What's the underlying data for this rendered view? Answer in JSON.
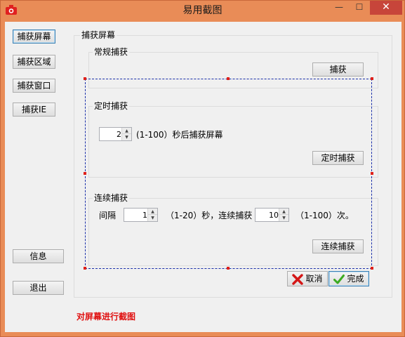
{
  "window": {
    "title": "易用截图"
  },
  "sidebar": {
    "capture_screen": "捕获屏幕",
    "capture_region": "捕获区域",
    "capture_window": "捕获窗口",
    "capture_ie": "捕获IE",
    "info": "信息",
    "exit": "退出"
  },
  "panel": {
    "title": "捕获屏幕",
    "normal": {
      "title": "常规捕获",
      "button": "捕获"
    },
    "timed": {
      "title": "定时捕获",
      "delay_value": "2",
      "range_text": "(1-100）秒后捕获屏幕",
      "button": "定时捕获"
    },
    "continuous": {
      "title": "连续捕获",
      "interval_label": "间隔",
      "interval_value": "1",
      "interval_range": "（1-20）秒，连续捕获",
      "count_value": "10",
      "count_range": "（1-100）次。",
      "button": "连续捕获"
    }
  },
  "actions": {
    "cancel": "取消",
    "done": "完成"
  },
  "status": "对屏幕进行截图",
  "colors": {
    "titlebar": "#e98c57",
    "close": "#c7453a",
    "status": "#e01010",
    "selection": "#1a2faa",
    "handle": "#e0201a"
  }
}
